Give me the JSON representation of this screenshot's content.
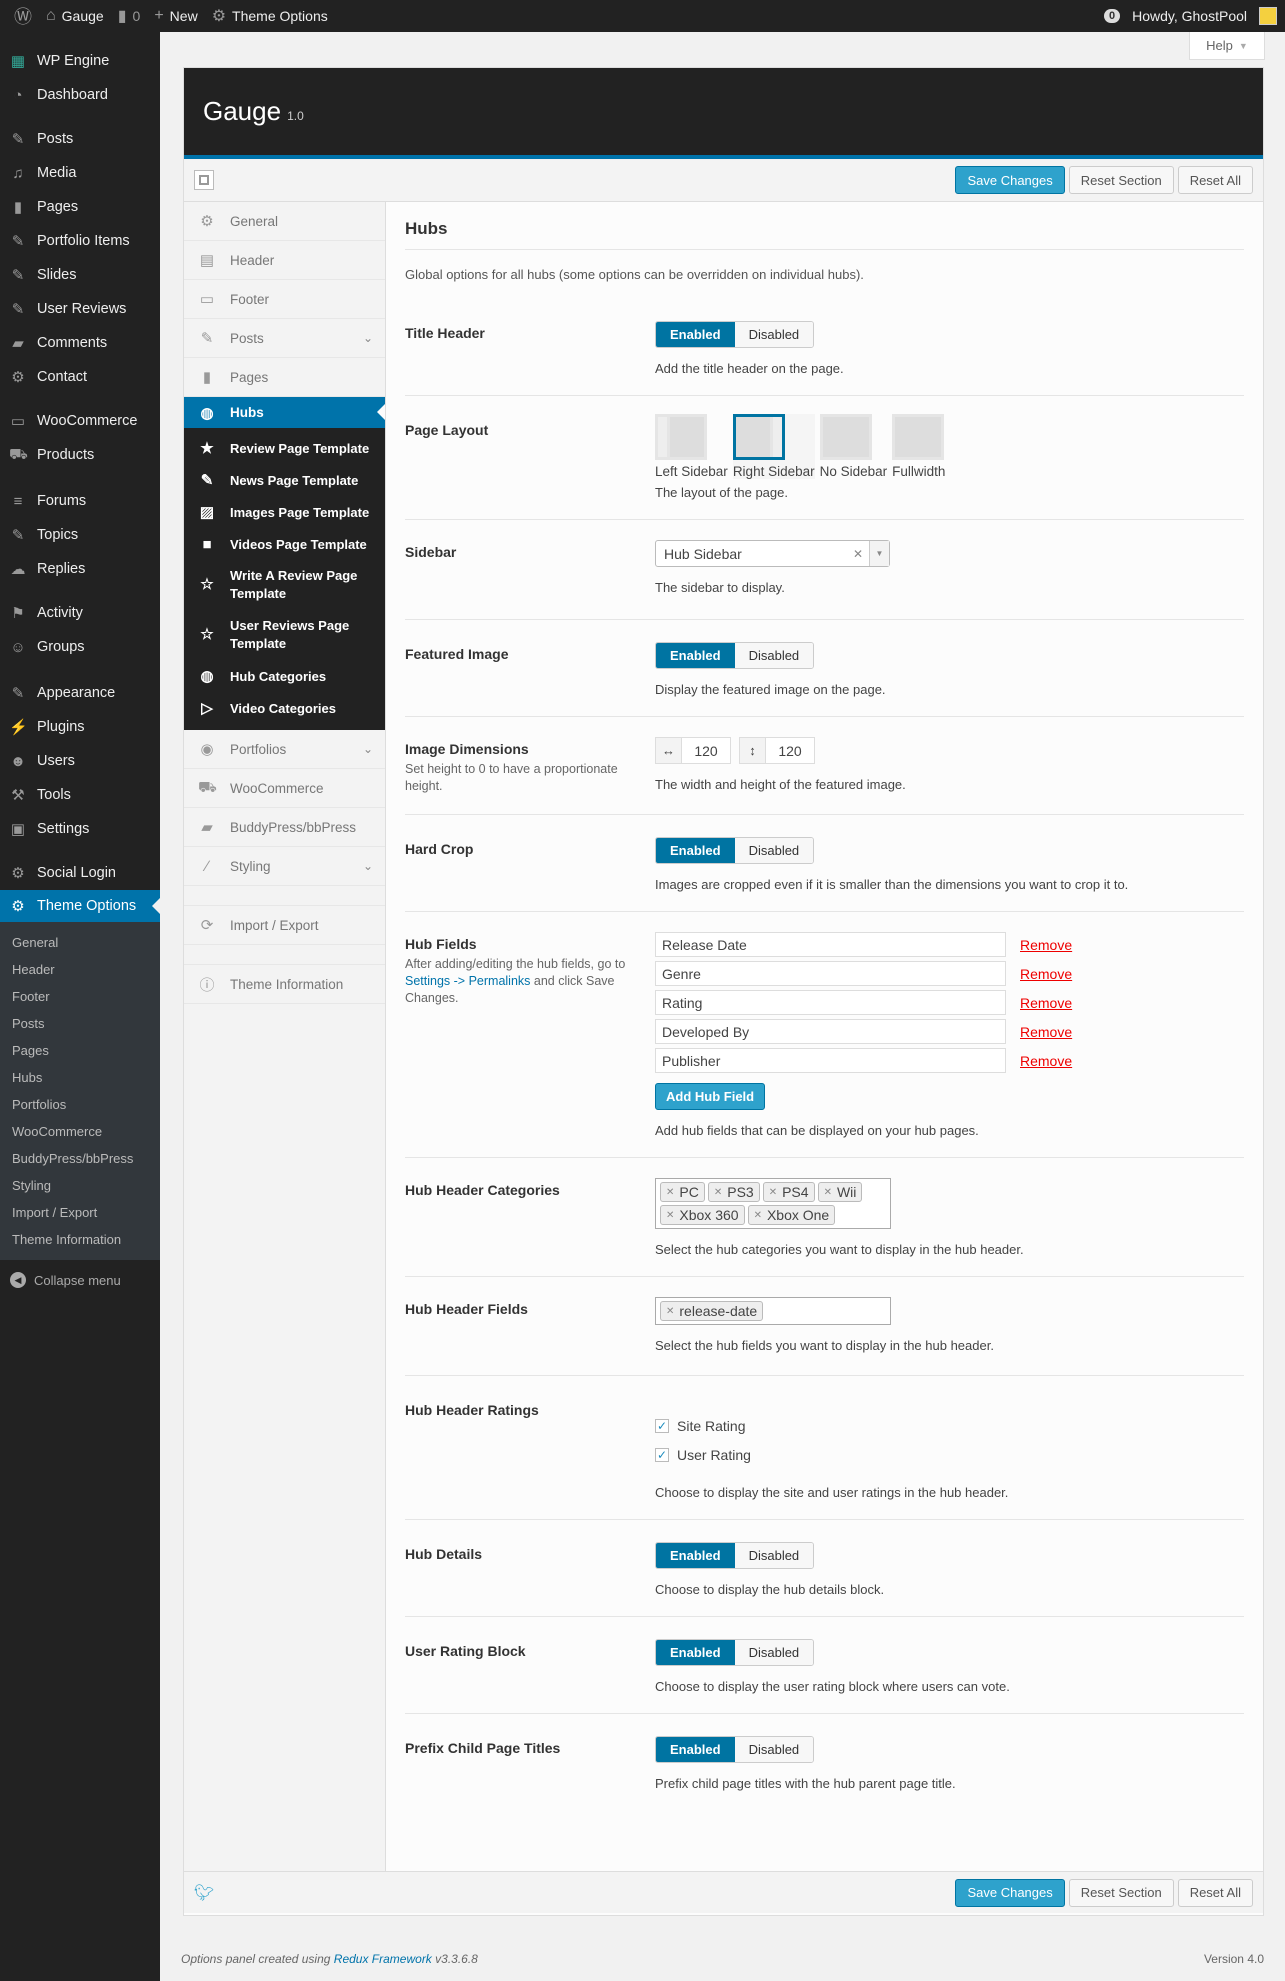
{
  "adminbar": {
    "site": "Gauge",
    "comments": "0",
    "new": "New",
    "theme_options": "Theme Options",
    "notifications": "0",
    "howdy": "Howdy, GhostPool"
  },
  "menu": {
    "items": [
      "WP Engine",
      "Dashboard",
      "Posts",
      "Media",
      "Pages",
      "Portfolio Items",
      "Slides",
      "User Reviews",
      "Comments",
      "Contact",
      "WooCommerce",
      "Products",
      "Forums",
      "Topics",
      "Replies",
      "Activity",
      "Groups",
      "Appearance",
      "Plugins",
      "Users",
      "Tools",
      "Settings",
      "Social Login",
      "Theme Options"
    ],
    "submenu": [
      "General",
      "Header",
      "Footer",
      "Posts",
      "Pages",
      "Hubs",
      "Portfolios",
      "WooCommerce",
      "BuddyPress/bbPress",
      "Styling",
      "Import / Export",
      "Theme Information"
    ],
    "collapse": "Collapse menu"
  },
  "help": "Help",
  "panel": {
    "title": "Gauge",
    "version": "1.0",
    "save": "Save Changes",
    "reset_section": "Reset Section",
    "reset_all": "Reset All"
  },
  "options_nav": {
    "top": [
      "General",
      "Header",
      "Footer",
      "Posts",
      "Pages"
    ],
    "active": "Hubs",
    "hubs_sub": [
      "Review Page Template",
      "News Page Template",
      "Images Page Template",
      "Videos Page Template",
      "Write A Review Page Template",
      "User Reviews Page Template",
      "Hub Categories",
      "Video Categories"
    ],
    "bottom": [
      "Portfolios",
      "WooCommerce",
      "BuddyPress/bbPress",
      "Styling"
    ],
    "import_export": "Import / Export",
    "theme_info": "Theme Information"
  },
  "content": {
    "title": "Hubs",
    "intro": "Global options for all hubs (some options can be overridden on individual hubs).",
    "enabled": "Enabled",
    "disabled": "Disabled",
    "title_header": {
      "label": "Title Header",
      "desc": "Add the title header on the page.",
      "value": "Enabled"
    },
    "page_layout": {
      "label": "Page Layout",
      "options": [
        "Left Sidebar",
        "Right Sidebar",
        "No Sidebar",
        "Fullwidth"
      ],
      "selected": "Right Sidebar",
      "desc": "The layout of the page."
    },
    "sidebar": {
      "label": "Sidebar",
      "value": "Hub Sidebar",
      "desc": "The sidebar to display."
    },
    "featured_image": {
      "label": "Featured Image",
      "desc": "Display the featured image on the page.",
      "value": "Enabled"
    },
    "image_dimensions": {
      "label": "Image Dimensions",
      "sub": "Set height to 0 to have a proportionate height.",
      "width": "120",
      "height": "120",
      "desc": "The width and height of the featured image."
    },
    "hard_crop": {
      "label": "Hard Crop",
      "desc": "Images are cropped even if it is smaller than the dimensions you want to crop it to.",
      "value": "Enabled"
    },
    "hub_fields": {
      "label": "Hub Fields",
      "sub_pre": "After adding/editing the hub fields, go to",
      "sub_link": "Settings -> Permalinks",
      "sub_post": "and click Save Changes.",
      "fields": [
        "Release Date",
        "Genre",
        "Rating",
        "Developed By",
        "Publisher"
      ],
      "remove": "Remove",
      "add": "Add Hub Field",
      "desc": "Add hub fields that can be displayed on your hub pages."
    },
    "hub_header_categories": {
      "label": "Hub Header Categories",
      "tags": [
        "PC",
        "PS3",
        "PS4",
        "Wii",
        "Xbox 360",
        "Xbox One"
      ],
      "desc": "Select the hub categories you want to display in the hub header."
    },
    "hub_header_fields": {
      "label": "Hub Header Fields",
      "tags": [
        "release-date"
      ],
      "desc": "Select the hub fields you want to display in the hub header."
    },
    "hub_header_ratings": {
      "label": "Hub Header Ratings",
      "options": [
        "Site Rating",
        "User Rating"
      ],
      "desc": "Choose to display the site and user ratings in the hub header."
    },
    "hub_details": {
      "label": "Hub Details",
      "desc": "Choose to display the hub details block.",
      "value": "Enabled"
    },
    "user_rating_block": {
      "label": "User Rating Block",
      "desc": "Choose to display the user rating block where users can vote.",
      "value": "Enabled"
    },
    "prefix_child": {
      "label": "Prefix Child Page Titles",
      "desc": "Prefix child page titles with the hub parent page title.",
      "value": "Enabled"
    }
  },
  "footer": {
    "credit_pre": "Options panel created using",
    "credit_link": "Redux Framework",
    "credit_post": "v3.3.6.8",
    "version": "Version 4.0"
  }
}
